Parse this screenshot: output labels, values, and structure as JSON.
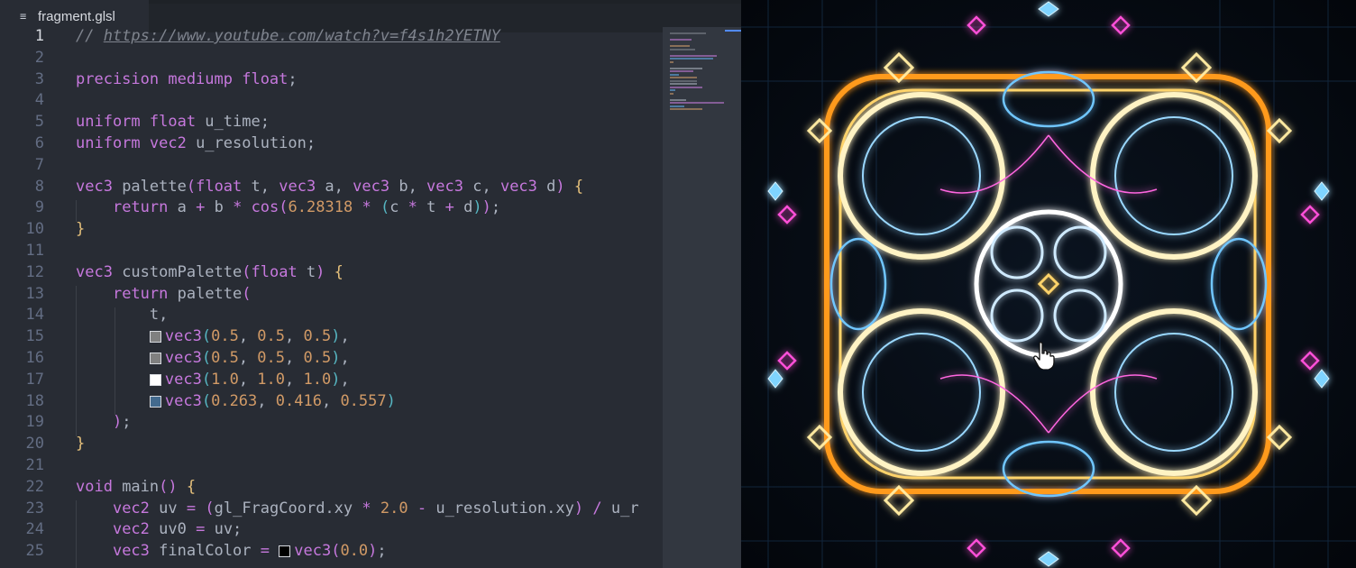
{
  "tab": {
    "title": "fragment.glsl",
    "icon": "menu-lines-icon"
  },
  "active_line": "1",
  "code_lines": [
    {
      "n": "1",
      "html": "<span class=\"comment\">// </span><span class=\"link\">https://www.youtube.com/watch?v=f4s1h2YETNY</span>"
    },
    {
      "n": "2",
      "html": ""
    },
    {
      "n": "3",
      "html": "<span class=\"kw\">precision mediump float</span>;"
    },
    {
      "n": "4",
      "html": ""
    },
    {
      "n": "5",
      "html": "<span class=\"kw\">uniform float</span> u_time;"
    },
    {
      "n": "6",
      "html": "<span class=\"kw\">uniform vec2</span> u_resolution;"
    },
    {
      "n": "7",
      "html": ""
    },
    {
      "n": "8",
      "html": "<span class=\"kw\">vec3</span> palette<span class=\"br2\">(</span><span class=\"kw\">float</span> t, <span class=\"kw\">vec3</span> a, <span class=\"kw\">vec3</span> b, <span class=\"kw\">vec3</span> c, <span class=\"kw\">vec3</span> d<span class=\"br2\">)</span> <span class=\"br1\">{</span>"
    },
    {
      "n": "9",
      "html": "    <span class=\"kw\">return</span> a <span class=\"op\">+</span> b <span class=\"op\">*</span> <span class=\"kw\">cos</span><span class=\"br2\">(</span><span class=\"num\">6.28318</span> <span class=\"op\">*</span> <span class=\"br3\">(</span>c <span class=\"op\">*</span> t <span class=\"op\">+</span> d<span class=\"br3\">)</span><span class=\"br2\">)</span>;"
    },
    {
      "n": "10",
      "html": "<span class=\"br1\">}</span>"
    },
    {
      "n": "11",
      "html": ""
    },
    {
      "n": "12",
      "html": "<span class=\"kw\">vec3</span> customPalette<span class=\"br2\">(</span><span class=\"kw\">float</span> t<span class=\"br2\">)</span> <span class=\"br1\">{</span>"
    },
    {
      "n": "13",
      "html": "    <span class=\"kw\">return</span> palette<span class=\"br2\">(</span>"
    },
    {
      "n": "14",
      "html": "        t,"
    },
    {
      "n": "15",
      "html": "        <span class=\"swatch\" style=\"background:#808080\"></span><span class=\"kw\">vec3</span><span class=\"br3\">(</span><span class=\"num\">0.5</span>, <span class=\"num\">0.5</span>, <span class=\"num\">0.5</span><span class=\"br3\">)</span>,"
    },
    {
      "n": "16",
      "html": "        <span class=\"swatch\" style=\"background:#808080\"></span><span class=\"kw\">vec3</span><span class=\"br3\">(</span><span class=\"num\">0.5</span>, <span class=\"num\">0.5</span>, <span class=\"num\">0.5</span><span class=\"br3\">)</span>,"
    },
    {
      "n": "17",
      "html": "        <span class=\"swatch\" style=\"background:#ffffff\"></span><span class=\"kw\">vec3</span><span class=\"br3\">(</span><span class=\"num\">1.0</span>, <span class=\"num\">1.0</span>, <span class=\"num\">1.0</span><span class=\"br3\">)</span>,"
    },
    {
      "n": "18",
      "html": "        <span class=\"swatch\" style=\"background:#436a8e\"></span><span class=\"kw\">vec3</span><span class=\"br3\">(</span><span class=\"num\">0.263</span>, <span class=\"num\">0.416</span>, <span class=\"num\">0.557</span><span class=\"br3\">)</span>"
    },
    {
      "n": "19",
      "html": "    <span class=\"br2\">)</span>;"
    },
    {
      "n": "20",
      "html": "<span class=\"br1\">}</span>"
    },
    {
      "n": "21",
      "html": ""
    },
    {
      "n": "22",
      "html": "<span class=\"kw\">void</span> main<span class=\"br2\">()</span> <span class=\"br1\">{</span>"
    },
    {
      "n": "23",
      "html": "    <span class=\"kw\">vec2</span> uv <span class=\"op\">=</span> <span class=\"br2\">(</span>gl_FragCoord.xy <span class=\"op\">*</span> <span class=\"num\">2.0</span> <span class=\"op\">-</span> u_resolution.xy<span class=\"br2\">)</span> <span class=\"op\">/</span> u_r"
    },
    {
      "n": "24",
      "html": "    <span class=\"kw\">vec2</span> uv0 <span class=\"op\">=</span> uv;"
    },
    {
      "n": "25",
      "html": "    <span class=\"kw\">vec3</span> finalColor <span class=\"op\">=</span> <span class=\"swatch\" style=\"background:#000000\"></span><span class=\"kw\">vec3</span><span class=\"br2\">(</span><span class=\"num\">0.0</span><span class=\"br2\">)</span>;"
    }
  ],
  "colors": {
    "editor_bg": "#282c34",
    "keyword": "#c678dd",
    "number": "#d19a66",
    "function": "#61afef",
    "bracket1": "#e5c07b"
  },
  "preview": {
    "type": "shader-output"
  },
  "cursor": "hand-pointer-icon"
}
